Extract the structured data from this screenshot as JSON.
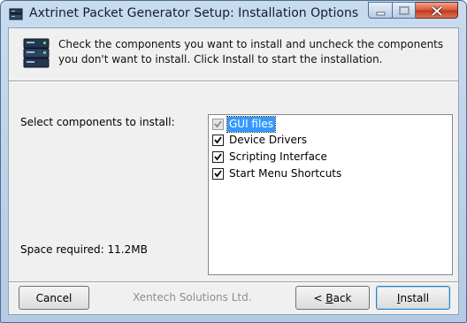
{
  "window": {
    "title": "Axtrinet Packet Generator Setup: Installation Options",
    "icon": "installer-icon",
    "controls": {
      "minimize_icon": "minimize-icon",
      "maximize_icon": "maximize-icon",
      "close_icon": "close-icon"
    }
  },
  "header": {
    "icon": "computer-tower-icon",
    "description": "Check the components you want to install and uncheck the components you don't want to install. Click Install to start the installation."
  },
  "body": {
    "select_label": "Select components to install:",
    "space_label": "Space required: 11.2MB",
    "components": [
      {
        "label": "GUI files",
        "checked": true,
        "disabled": true,
        "selected": true
      },
      {
        "label": "Device Drivers",
        "checked": true,
        "disabled": false,
        "selected": false
      },
      {
        "label": "Scripting Interface",
        "checked": true,
        "disabled": false,
        "selected": false
      },
      {
        "label": "Start Menu Shortcuts",
        "checked": true,
        "disabled": false,
        "selected": false
      }
    ]
  },
  "footer": {
    "cancel_label": "Cancel",
    "brand": "Xentech Solutions Ltd.",
    "back_prefix": "< ",
    "back_accel": "B",
    "back_rest": "ack",
    "install_accel": "I",
    "install_rest": "nstall"
  },
  "colors": {
    "selection": "#3399ff",
    "frame": "#b9d1ea",
    "client": "#f0f0f0"
  }
}
